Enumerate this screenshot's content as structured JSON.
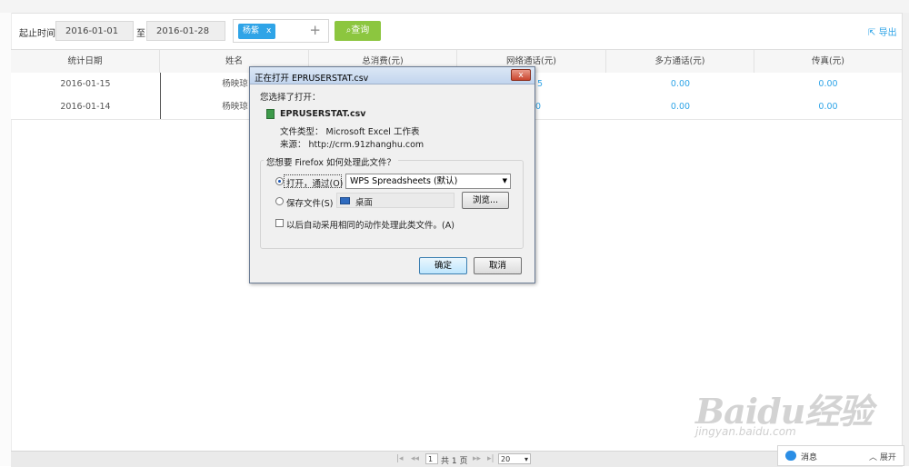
{
  "filter": {
    "start_label": "起止时间",
    "start_date": "2016-01-01",
    "to_label": "至",
    "end_date": "2016-01-28",
    "tag": "杨紫",
    "tag_remove": "x",
    "add": "+",
    "query_label": "查询",
    "export_label": "导出"
  },
  "table": {
    "headers": [
      "统计日期",
      "姓名",
      "总消费(元)",
      "网络通话(元)",
      "多方通话(元)",
      "传真(元)"
    ],
    "rows": [
      {
        "date": "2016-01-15",
        "name": "杨映琼",
        "network": "5",
        "multi": "0.00",
        "fax": "0.00"
      },
      {
        "date": "2016-01-14",
        "name": "杨映琼",
        "network": "0",
        "multi": "0.00",
        "fax": "0.00"
      }
    ]
  },
  "pager": {
    "first": "|◂",
    "prev": "◂◂",
    "page": "1",
    "total": "共 1 页",
    "next": "▸▸",
    "last": "▸|",
    "page_size": "20"
  },
  "chat": {
    "label": "消息",
    "expand": "展开"
  },
  "watermark": {
    "logo": "Baidu经验",
    "url": "jingyan.baidu.com"
  },
  "dialog": {
    "title": "正在打开 EPRUSERSTAT.csv",
    "close": "x",
    "chosen_label": "您选择了打开：",
    "filename": "EPRUSERSTAT.csv",
    "filetype": "文件类型： Microsoft Excel 工作表",
    "source": "来源： http://crm.91zhanghu.com",
    "question": "您想要 Firefox 如何处理此文件？",
    "open_with_label": "打开，通过(O)",
    "open_with_app": "WPS Spreadsheets (默认)",
    "save_label": "保存文件(S)",
    "save_location": "桌面",
    "browse": "浏览...",
    "auto_label": "以后自动采用相同的动作处理此类文件。(A)",
    "ok": "确定",
    "cancel": "取消"
  }
}
